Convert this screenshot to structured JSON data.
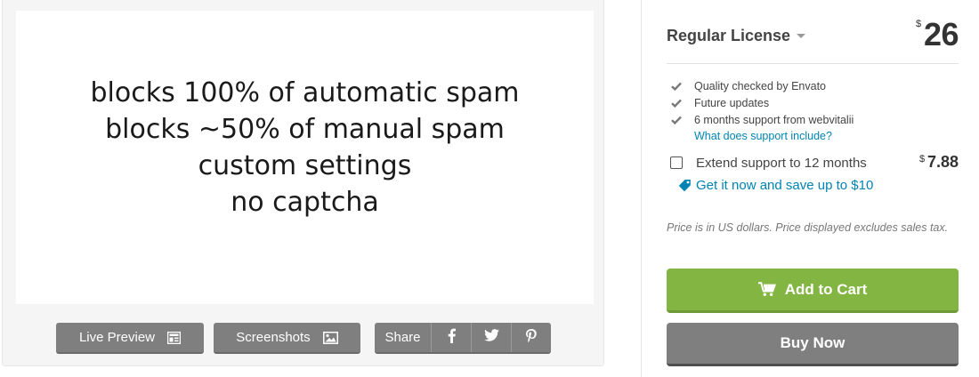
{
  "preview": {
    "lines": [
      "blocks 100% of automatic spam",
      "blocks ~50% of manual spam",
      "custom settings",
      "no captcha"
    ]
  },
  "actions": {
    "live_preview_label": "Live Preview",
    "screenshots_label": "Screenshots",
    "share_label": "Share",
    "social_icons": [
      "facebook-icon",
      "twitter-icon",
      "pinterest-icon"
    ]
  },
  "purchase": {
    "license_label": "Regular License",
    "currency_symbol": "$",
    "price": "26",
    "features": [
      "Quality checked by Envato",
      "Future updates",
      "6 months support from webvitalii"
    ],
    "support_link": "What does support include?",
    "extend_label": "Extend support to 12 months",
    "extend_price": "7.88",
    "extend_checked": false,
    "save_link": "Get it now and save up to $10",
    "price_note": "Price is in US dollars. Price displayed excludes sales tax.",
    "add_to_cart_label": "Add to Cart",
    "buy_now_label": "Buy Now"
  },
  "colors": {
    "accent_green": "#82b541",
    "button_gray": "#7f7f7f",
    "link_blue": "#0084b4",
    "check_gray": "#777777"
  }
}
